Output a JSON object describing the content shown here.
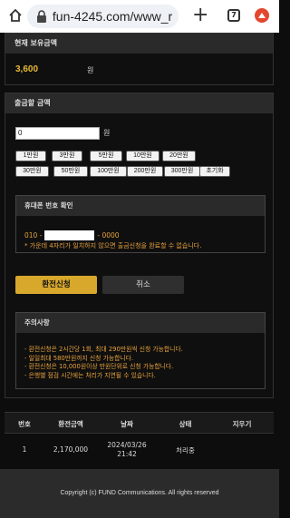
{
  "browser": {
    "url": "fun-4245.com/www_r",
    "tab_count": "7"
  },
  "balance": {
    "heading": "현재 보유금액",
    "amount": "3,600",
    "unit": "원"
  },
  "withdraw": {
    "heading": "출금할 금액",
    "input_value": "0",
    "unit": "원",
    "quick_buttons_row1": [
      "1만원",
      "3만원",
      "5만원",
      "10만원",
      "20만원"
    ],
    "quick_buttons_row2": [
      "30만원",
      "50만원",
      "100만원",
      "200만원",
      "300만원",
      "초기화"
    ],
    "phone": {
      "heading": "휴대폰 번호 확인",
      "prefix": "010 -",
      "suffix": "- 0000",
      "note": "* 가운데 4자리가 일치하지 않으면 출금신청을 완료할 수 없습니다."
    },
    "apply_label": "환전신청",
    "cancel_label": "취소",
    "notice": {
      "heading": "주의사항",
      "items": [
        "- 환전신청은 2시간당 1회, 최대 290만원씩 신청 가능합니다.",
        "- 일일최대 580만원까지 신청 가능합니다.",
        "- 환전신청은 10,000원이상 만원단위로 신청 가능합니다.",
        "- 은행별 점검 시간에는 처리가 지연될 수 있습니다."
      ]
    }
  },
  "history": {
    "columns": [
      "번호",
      "환전금액",
      "날짜",
      "상태",
      "지우기"
    ],
    "rows": [
      {
        "no": "1",
        "amount": "2,170,000",
        "date": "2024/03/26",
        "time": "21:42",
        "status": "처리중"
      }
    ]
  },
  "footer": {
    "copyright": "Copyright (c) FUND Communications. All rights reserved"
  },
  "colors": {
    "accent": "#d8a82c",
    "notice_text": "#e8a23c",
    "background": "#0d0d0d"
  }
}
